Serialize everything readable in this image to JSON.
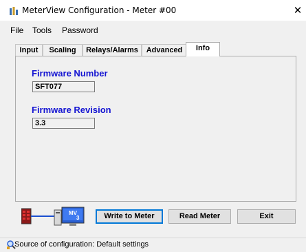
{
  "window": {
    "title": "MeterView Configuration - Meter #00",
    "close_glyph": "✕"
  },
  "menu": {
    "items": [
      "File",
      "Tools",
      "Password"
    ]
  },
  "tabs": [
    {
      "label": "Input"
    },
    {
      "label": "Scaling"
    },
    {
      "label": "Relays/Alarms"
    },
    {
      "label": "Advanced"
    },
    {
      "label": "Info"
    }
  ],
  "active_tab": "Info",
  "info": {
    "firmware_number_label": "Firmware Number",
    "firmware_number_value": "SFT077",
    "firmware_revision_label": "Firmware Revision",
    "firmware_revision_value": "3.3"
  },
  "device": {
    "badge_text": "MV",
    "badge_number": "3"
  },
  "buttons": {
    "write": "Write to Meter",
    "read": "Read Meter",
    "exit": "Exit"
  },
  "status": {
    "text": "Source of configuration: Default settings"
  },
  "colors": {
    "accent_text": "#1414d2",
    "focus_border": "#0078d7"
  },
  "icons": {
    "app": "meter-app-icon",
    "status": "search-settings-icon"
  }
}
